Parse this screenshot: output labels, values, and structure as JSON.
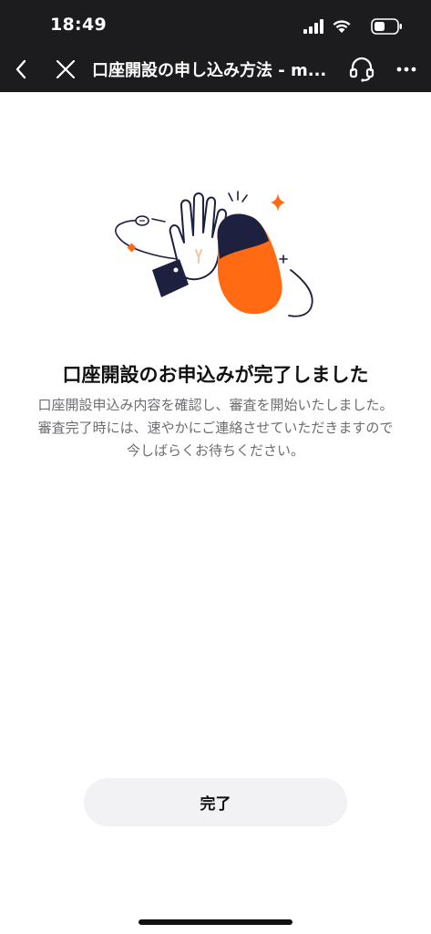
{
  "status_bar": {
    "time": "18:49"
  },
  "nav": {
    "title": "口座開設の申し込み方法 - m...",
    "icons": [
      "chevron-left-icon",
      "close-icon",
      "headset-icon",
      "more-icon"
    ]
  },
  "content": {
    "headline": "口座開設のお申込みが完了しました",
    "body_lines": [
      "口座開設申込み内容を確認し、審査を開始いたしました。",
      "審査完了時には、速やかにご連絡させていただきますので",
      "今しばらくお待ちください。"
    ]
  },
  "actions": {
    "done_label": "完了"
  },
  "colors": {
    "topbar_bg": "#1c1c1e",
    "accent_orange": "#ff6a13",
    "navy": "#1e2040",
    "button_bg": "#f2f2f4"
  }
}
